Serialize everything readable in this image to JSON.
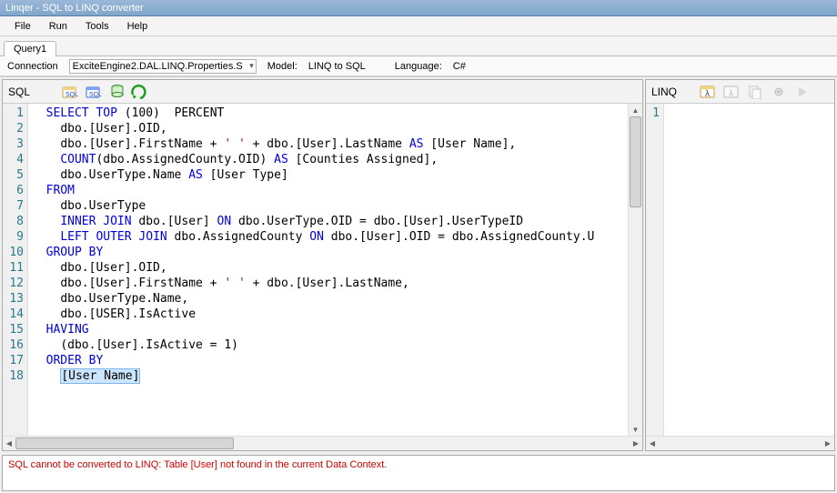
{
  "title": "Linqer - SQL to LINQ converter",
  "menu": {
    "file": "File",
    "run": "Run",
    "tools": "Tools",
    "help": "Help"
  },
  "tab": {
    "label": "Query1"
  },
  "options": {
    "connection_label": "Connection",
    "connection_value": "ExciteEngine2.DAL.LINQ.Properties.S",
    "model_label": "Model:",
    "model_value": "LINQ to SQL",
    "language_label": "Language:",
    "language_value": "C#"
  },
  "left_pane_label": "SQL",
  "right_pane_label": "LINQ",
  "line_count": 18,
  "right_line_count": 1,
  "error": "SQL cannot be converted to LINQ: Table [User] not found in the current Data Context.",
  "sql_lines": [
    {
      "indent": 0,
      "tokens": [
        [
          "kw",
          "SELECT"
        ],
        [
          "sp",
          " "
        ],
        [
          "kw",
          "TOP"
        ],
        [
          "sp",
          " "
        ],
        [
          "txt",
          "("
        ],
        [
          "num",
          "100"
        ],
        [
          "txt",
          ")"
        ],
        [
          "sp",
          "  "
        ],
        [
          "txt",
          "PERCENT"
        ]
      ]
    },
    {
      "indent": 1,
      "tokens": [
        [
          "txt",
          "dbo.[User].OID,"
        ]
      ]
    },
    {
      "indent": 1,
      "tokens": [
        [
          "txt",
          "dbo.[User].FirstName + "
        ],
        [
          "str",
          "' '"
        ],
        [
          "txt",
          " + dbo.[User].LastName "
        ],
        [
          "kw",
          "AS"
        ],
        [
          "txt",
          " [User Name],"
        ]
      ]
    },
    {
      "indent": 1,
      "tokens": [
        [
          "kw",
          "COUNT"
        ],
        [
          "txt",
          "(dbo.AssignedCounty.OID) "
        ],
        [
          "kw",
          "AS"
        ],
        [
          "txt",
          " [Counties Assigned],"
        ]
      ]
    },
    {
      "indent": 1,
      "tokens": [
        [
          "txt",
          "dbo.UserType.Name "
        ],
        [
          "kw",
          "AS"
        ],
        [
          "txt",
          " [User Type]"
        ]
      ]
    },
    {
      "indent": 0,
      "tokens": [
        [
          "kw",
          "FROM"
        ]
      ]
    },
    {
      "indent": 1,
      "tokens": [
        [
          "txt",
          "dbo.UserType"
        ]
      ]
    },
    {
      "indent": 1,
      "tokens": [
        [
          "kw",
          "INNER"
        ],
        [
          "sp",
          " "
        ],
        [
          "kw",
          "JOIN"
        ],
        [
          "txt",
          " dbo.[User] "
        ],
        [
          "kw",
          "ON"
        ],
        [
          "txt",
          " dbo.UserType.OID = dbo.[User].UserTypeID"
        ]
      ]
    },
    {
      "indent": 1,
      "tokens": [
        [
          "kw",
          "LEFT"
        ],
        [
          "sp",
          " "
        ],
        [
          "kw",
          "OUTER"
        ],
        [
          "sp",
          " "
        ],
        [
          "kw",
          "JOIN"
        ],
        [
          "txt",
          " dbo.AssignedCounty "
        ],
        [
          "kw",
          "ON"
        ],
        [
          "txt",
          " dbo.[User].OID = dbo.AssignedCounty.U"
        ]
      ]
    },
    {
      "indent": 0,
      "tokens": [
        [
          "kw",
          "GROUP"
        ],
        [
          "sp",
          " "
        ],
        [
          "kw",
          "BY"
        ]
      ]
    },
    {
      "indent": 1,
      "tokens": [
        [
          "txt",
          "dbo.[User].OID,"
        ]
      ]
    },
    {
      "indent": 1,
      "tokens": [
        [
          "txt",
          "dbo.[User].FirstName + "
        ],
        [
          "str",
          "' '"
        ],
        [
          "txt",
          " + dbo.[User].LastName,"
        ]
      ]
    },
    {
      "indent": 1,
      "tokens": [
        [
          "txt",
          "dbo.UserType.Name,"
        ]
      ]
    },
    {
      "indent": 1,
      "tokens": [
        [
          "txt",
          "dbo.[USER].IsActive"
        ]
      ]
    },
    {
      "indent": 0,
      "tokens": [
        [
          "kw",
          "HAVING"
        ]
      ]
    },
    {
      "indent": 1,
      "tokens": [
        [
          "txt",
          "(dbo.[User].IsActive = "
        ],
        [
          "num",
          "1"
        ],
        [
          "txt",
          ")"
        ]
      ]
    },
    {
      "indent": 0,
      "tokens": [
        [
          "kw",
          "ORDER"
        ],
        [
          "sp",
          " "
        ],
        [
          "kw",
          "BY"
        ]
      ]
    },
    {
      "indent": 1,
      "tokens": [
        [
          "sel",
          "[User Name]"
        ]
      ]
    }
  ]
}
